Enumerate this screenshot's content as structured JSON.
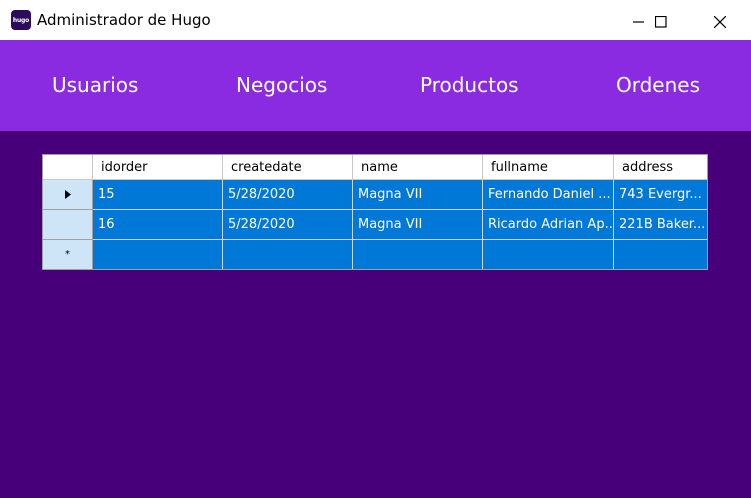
{
  "window": {
    "title": "Administrador de Hugo",
    "icon_text": "hugo"
  },
  "nav": {
    "items": [
      "Usuarios",
      "Negocios",
      "Productos",
      "Ordenes"
    ]
  },
  "table": {
    "columns": [
      "idorder",
      "createdate",
      "name",
      "fullname",
      "address"
    ],
    "rows": [
      [
        "15",
        "5/28/2020",
        "Magna VII",
        "Fernando Daniel ...",
        "743 Evergr..."
      ],
      [
        "16",
        "5/28/2020",
        "Magna VII",
        "Ricardo Adrian Ap...",
        "221B Baker..."
      ]
    ],
    "current_row_marker": "▶",
    "new_row_marker": "*"
  },
  "colors": {
    "background": "#48007a",
    "navbar": "#8a2be2",
    "selection": "#0078d7",
    "row_header": "#cde5f7"
  }
}
